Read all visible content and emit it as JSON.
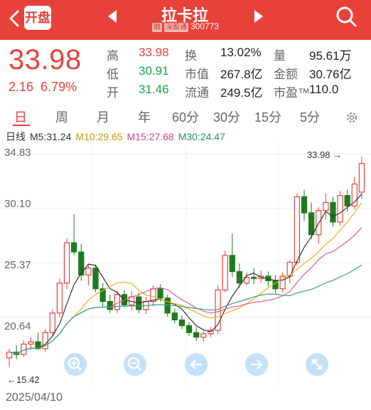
{
  "header": {
    "badge": "开盘",
    "title": "拉卡拉",
    "tag_rong": "融",
    "tag_market": "深股通",
    "code": "300773"
  },
  "quote": {
    "price": "33.98",
    "change": "2.16",
    "change_pct": "6.79%",
    "stats": [
      [
        {
          "label": "高",
          "value": "33.98",
          "color": "red"
        },
        {
          "label": "换",
          "value": "13.02%",
          "color": "dark"
        },
        {
          "label": "量",
          "value": "95.61万",
          "color": "dark"
        }
      ],
      [
        {
          "label": "低",
          "value": "30.91",
          "color": "green"
        },
        {
          "label": "市值",
          "value": "267.8亿",
          "color": "dark"
        },
        {
          "label": "金额",
          "value": "30.76亿",
          "color": "dark"
        }
      ],
      [
        {
          "label": "开",
          "value": "31.46",
          "color": "green"
        },
        {
          "label": "流通",
          "value": "249.5亿",
          "color": "dark"
        },
        {
          "label": "市盈™",
          "value": "110.0",
          "color": "dark"
        }
      ]
    ]
  },
  "tabs": [
    "日",
    "周",
    "月",
    "年",
    "60分",
    "30分",
    "15分",
    "5分"
  ],
  "ma": {
    "label": "日线",
    "m5": "M5:31.24",
    "m10": "M10:29.65",
    "m15": "M15:27.68",
    "m30": "M30:24.47"
  },
  "colors": {
    "up": "#e8413a",
    "down": "#1f7a1f",
    "m5": "#333333",
    "m10": "#e6b422",
    "m15": "#e05a9a",
    "m30": "#3aa37a"
  },
  "chart_data": {
    "type": "candlestick",
    "y_ticks": [
      "34.83",
      "30.10",
      "25.37",
      "20.64"
    ],
    "ylim": [
      15.42,
      34.83
    ],
    "last_price_label": "33.98",
    "low_label": "15.42",
    "date_label": "2025/04/10",
    "candles": [
      [
        17.1,
        17.9,
        16.3,
        17.6
      ],
      [
        17.6,
        18.2,
        17.0,
        17.4
      ],
      [
        17.4,
        18.6,
        17.2,
        18.3
      ],
      [
        18.3,
        18.9,
        17.8,
        18.5
      ],
      [
        18.5,
        19.3,
        17.8,
        17.9
      ],
      [
        17.9,
        19.6,
        17.6,
        19.3
      ],
      [
        19.3,
        21.3,
        19.0,
        21.0
      ],
      [
        21.0,
        24.0,
        20.6,
        23.6
      ],
      [
        23.6,
        27.5,
        23.1,
        27.1
      ],
      [
        27.1,
        29.6,
        26.0,
        26.3
      ],
      [
        26.3,
        27.0,
        23.8,
        24.3
      ],
      [
        24.3,
        25.3,
        23.4,
        24.9
      ],
      [
        24.9,
        25.2,
        22.8,
        23.1
      ],
      [
        23.1,
        23.6,
        21.5,
        22.0
      ],
      [
        22.0,
        22.6,
        21.0,
        21.3
      ],
      [
        21.3,
        22.9,
        21.0,
        22.6
      ],
      [
        22.6,
        23.0,
        21.5,
        21.7
      ],
      [
        21.7,
        22.9,
        21.2,
        22.4
      ],
      [
        22.4,
        22.8,
        21.0,
        21.3
      ],
      [
        21.3,
        22.4,
        20.9,
        22.0
      ],
      [
        22.0,
        23.4,
        21.6,
        23.1
      ],
      [
        23.1,
        23.5,
        22.0,
        22.3
      ],
      [
        22.3,
        22.6,
        20.7,
        21.0
      ],
      [
        21.0,
        21.4,
        20.1,
        20.4
      ],
      [
        20.4,
        20.8,
        19.6,
        19.9
      ],
      [
        19.9,
        20.2,
        19.0,
        19.3
      ],
      [
        19.3,
        19.8,
        18.6,
        18.9
      ],
      [
        18.9,
        19.6,
        18.5,
        19.2
      ],
      [
        19.2,
        19.8,
        18.9,
        19.5
      ],
      [
        19.5,
        23.4,
        19.2,
        23.0
      ],
      [
        23.0,
        26.4,
        22.8,
        26.0
      ],
      [
        26.0,
        27.9,
        24.1,
        24.6
      ],
      [
        24.6,
        25.3,
        23.2,
        23.6
      ],
      [
        23.6,
        24.5,
        23.4,
        24.1
      ],
      [
        24.1,
        24.9,
        23.5,
        24.0
      ],
      [
        24.0,
        24.7,
        23.6,
        24.2
      ],
      [
        24.2,
        24.6,
        23.3,
        23.8
      ],
      [
        23.8,
        24.3,
        22.7,
        23.1
      ],
      [
        23.1,
        24.5,
        22.8,
        24.2
      ],
      [
        24.2,
        25.6,
        23.6,
        25.4
      ],
      [
        25.4,
        31.4,
        25.1,
        31.1
      ],
      [
        31.1,
        31.7,
        29.0,
        29.7
      ],
      [
        29.7,
        30.6,
        27.4,
        27.8
      ],
      [
        27.8,
        30.2,
        27.0,
        29.9
      ],
      [
        29.9,
        31.4,
        29.1,
        30.6
      ],
      [
        30.6,
        31.1,
        28.5,
        28.9
      ],
      [
        28.9,
        31.6,
        28.6,
        31.2
      ],
      [
        31.2,
        31.7,
        29.8,
        30.3
      ],
      [
        30.3,
        32.8,
        30.0,
        32.2
      ],
      [
        31.5,
        34.6,
        30.9,
        33.98
      ]
    ],
    "ma_note": "M5 M10 M15 M30 lines computed from candles"
  },
  "controls": [
    "zoom-in-icon",
    "zoom-out-icon",
    "arrow-left-icon",
    "arrow-right-icon",
    "expand-icon"
  ]
}
